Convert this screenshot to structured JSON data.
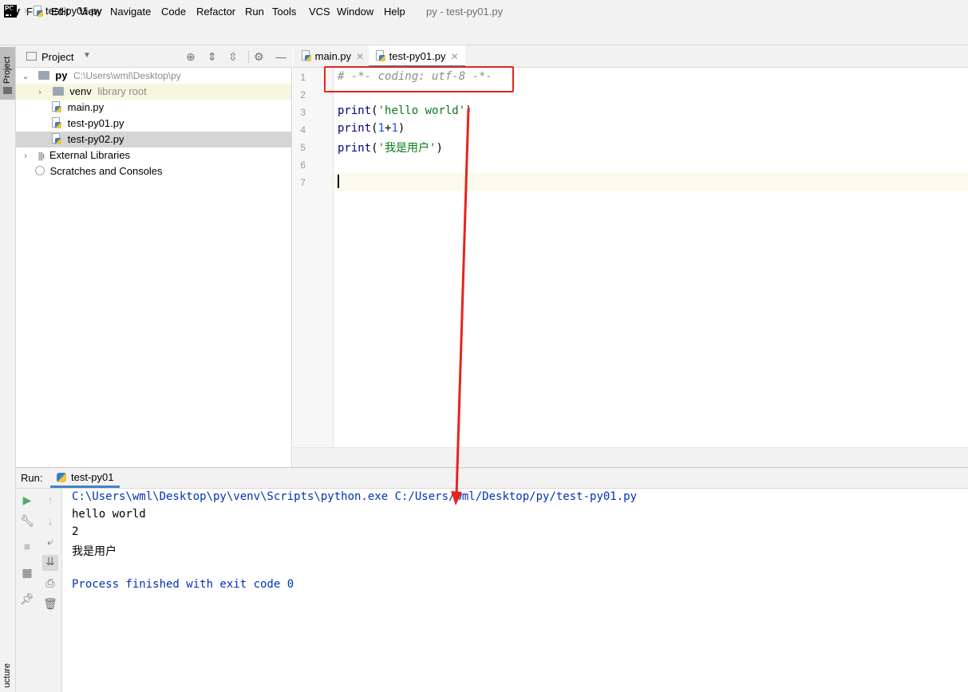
{
  "app": {
    "logo_text": "PC",
    "window_title": "py - test-py01.py",
    "menu": [
      "File",
      "Edit",
      "View",
      "Navigate",
      "Code",
      "Refactor",
      "Run",
      "Tools",
      "VCS",
      "Window",
      "Help"
    ]
  },
  "breadcrumb": {
    "root": "py",
    "file": "test-py01.py"
  },
  "stripes": {
    "project": "Project",
    "structure": "ucture"
  },
  "project_panel": {
    "title": "Project",
    "tree": [
      {
        "label": "py",
        "hint": "C:\\Users\\wml\\Desktop\\py",
        "type": "folder",
        "expanded": true
      },
      {
        "label": "venv",
        "hint": "library root",
        "type": "folder",
        "expanded": false
      },
      {
        "label": "main.py",
        "type": "python-file"
      },
      {
        "label": "test-py01.py",
        "type": "python-file"
      },
      {
        "label": "test-py02.py",
        "type": "python-file",
        "selected": true
      },
      {
        "label": "External Libraries",
        "type": "library",
        "expanded": false
      },
      {
        "label": "Scratches and Consoles",
        "type": "scratches"
      }
    ]
  },
  "editor": {
    "tabs": [
      {
        "label": "main.py",
        "active": false
      },
      {
        "label": "test-py01.py",
        "active": true
      }
    ],
    "line_numbers": [
      "1",
      "2",
      "3",
      "4",
      "5",
      "6",
      "7"
    ],
    "lines": {
      "l1": "# -*- coding: utf-8 -*-",
      "l3_fn": "print",
      "l3_open": "(",
      "l3_str": "'hello world'",
      "l3_close": ")",
      "l4_fn": "print",
      "l4_open": "(",
      "l4_a": "1",
      "l4_op": "+",
      "l4_b": "1",
      "l4_close": ")",
      "l5_fn": "print",
      "l5_open": "(",
      "l5_str": "'我是用户'",
      "l5_close": ")"
    },
    "caret_line": 7
  },
  "run_panel": {
    "label": "Run:",
    "tab": "test-py01",
    "output": {
      "command": "C:\\Users\\wml\\Desktop\\py\\venv\\Scripts\\python.exe C:/Users/wml/Desktop/py/test-py01.py",
      "line1": "hello world",
      "line2": "2",
      "line3": "我是用户",
      "finished": "Process finished with exit code 0"
    }
  },
  "colors": {
    "annotation": "#e8231c",
    "keyword": "#000080",
    "string": "#067d17",
    "number": "#1750eb",
    "accent": "#4083c9"
  }
}
